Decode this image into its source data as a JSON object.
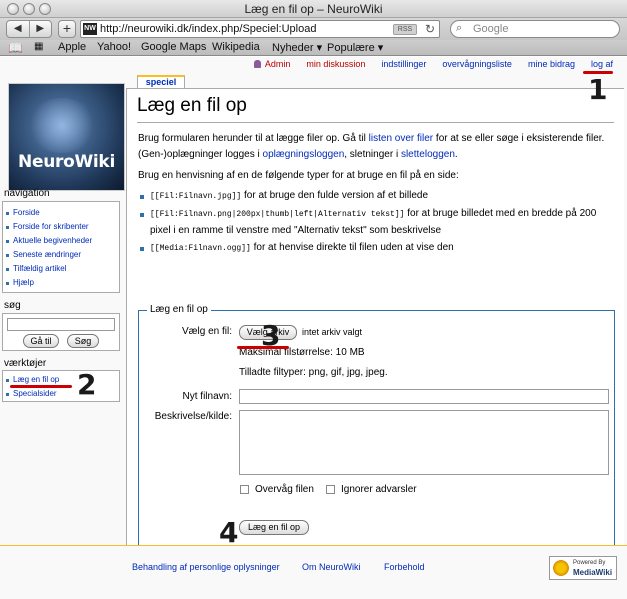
{
  "window": {
    "title": "Læg en fil op – NeuroWiki"
  },
  "toolbar": {
    "back": "◀",
    "forward": "▶",
    "plus": "+",
    "url": "http://neurowiki.dk/index.php/Speciel:Upload",
    "favicon": "NW",
    "rss": "RSS",
    "refresh": "↻",
    "search_placeholder": "Google"
  },
  "bookmarks": [
    "Apple",
    "Yahoo!",
    "Google Maps",
    "Wikipedia",
    "Nyheder ▾",
    "Populære ▾"
  ],
  "personal": {
    "user": "Admin",
    "talk": "min diskussion",
    "prefs": "indstillinger",
    "watchlist": "overvågningsliste",
    "contribs": "mine bidrag",
    "logout": "log af"
  },
  "logo_text": "NeuroWiki",
  "tab_label": "speciel",
  "page_title": "Læg en fil op",
  "intro": {
    "p1_a": "Brug formularen herunder til at lægge filer op. Gå til ",
    "p1_link1": "listen over filer",
    "p1_b": " for at se eller søge i eksisterende filer. (Gen-)oplægninger logges i ",
    "p1_link2": "oplægningsloggen",
    "p1_c": ", sletninger i ",
    "p1_link3": "sletteloggen",
    "p1_d": ".",
    "p2": "Brug en henvisning af en de følgende typer for at bruge en fil på en side:",
    "items": [
      {
        "code": "[[Fil:Filnavn.jpg]]",
        "text": " for at bruge den fulde version af et billede"
      },
      {
        "code": "[[Fil:Filnavn.png|200px|thumb|left|Alternativ tekst]]",
        "text": " for at bruge billedet med en bredde på 200 pixel i en ramme til venstre med \"Alternativ tekst\" som beskrivelse"
      },
      {
        "code": "[[Media:Filnavn.ogg]]",
        "text": " for at henvise direkte til filen uden at vise den"
      }
    ]
  },
  "form": {
    "legend": "Læg en fil op",
    "choose_label": "Vælg en fil:",
    "choose_button": "Vælg arkiv",
    "no_file": "intet arkiv valgt",
    "max_size": "Maksimal filstørrelse: 10 MB",
    "allowed": "Tilladte filtyper: png, gif, jpg, jpeg.",
    "newname_label": "Nyt filnavn:",
    "newname_value": "",
    "desc_label": "Beskrivelse/kilde:",
    "watch_label": "Overvåg filen",
    "ignore_label": "Ignorer advarsler",
    "submit": "Læg en fil op"
  },
  "sidebar": {
    "navigation_title": "navigation",
    "navigation": [
      "Forside",
      "Forside for skribenter",
      "Aktuelle begivenheder",
      "Seneste ændringer",
      "Tilfældig artikel",
      "Hjælp"
    ],
    "search_title": "søg",
    "search_go": "Gå til",
    "search_search": "Søg",
    "search_value": "",
    "tools_title": "værktøjer",
    "tools": [
      "Læg en fil op",
      "Specialsider"
    ]
  },
  "annotations": [
    "1",
    "2",
    "3",
    "4"
  ],
  "footer": {
    "privacy": "Behandling af personlige oplysninger",
    "about": "Om NeuroWiki",
    "disclaimer": "Forbehold",
    "powered_small": "Powered By",
    "powered_big": "MediaWiki"
  }
}
